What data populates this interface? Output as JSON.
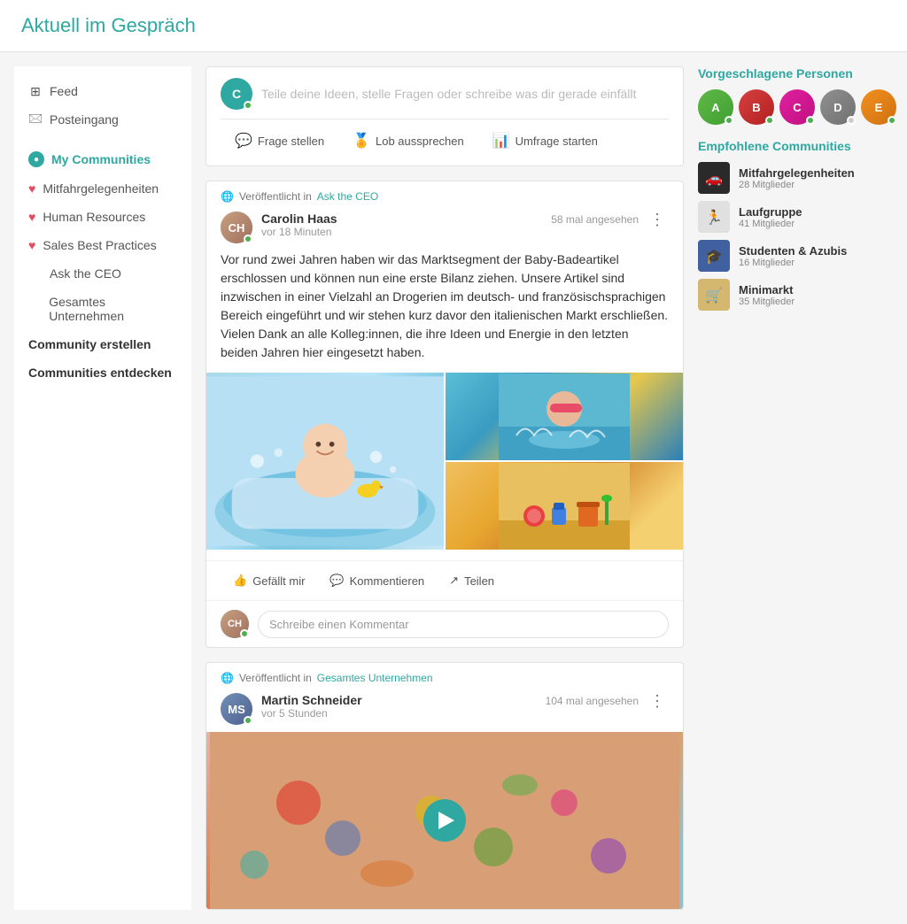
{
  "app": {
    "title": "Aktuell im Gespräch"
  },
  "sidebar": {
    "items": [
      {
        "id": "feed",
        "label": "Feed",
        "icon": "grid",
        "type": "nav"
      },
      {
        "id": "inbox",
        "label": "Posteingang",
        "icon": "inbox",
        "type": "nav"
      },
      {
        "id": "my-communities",
        "label": "My Communities",
        "icon": "community",
        "type": "section",
        "active": true
      },
      {
        "id": "mitfahrgelegenheiten",
        "label": "Mitfahrgelegenheiten",
        "icon": "heart",
        "type": "community"
      },
      {
        "id": "human-resources",
        "label": "Human Resources",
        "icon": "heart",
        "type": "community"
      },
      {
        "id": "sales-best-practices",
        "label": "Sales Best Practices",
        "icon": "heart",
        "type": "community"
      },
      {
        "id": "ask-the-ceo",
        "label": "Ask the CEO",
        "icon": "none",
        "type": "community"
      },
      {
        "id": "gesamtes-unternehmen",
        "label": "Gesamtes Unternehmen",
        "icon": "none",
        "type": "community"
      },
      {
        "id": "community-erstellen",
        "label": "Community erstellen",
        "icon": "none",
        "type": "action",
        "bold": true
      },
      {
        "id": "communities-entdecken",
        "label": "Communities entdecken",
        "icon": "none",
        "type": "action",
        "bold": true
      }
    ]
  },
  "composer": {
    "placeholder": "Teile deine Ideen, stelle Fragen oder schreibe was dir gerade einfällt",
    "actions": [
      {
        "id": "frage",
        "label": "Frage stellen",
        "icon": "💬"
      },
      {
        "id": "lob",
        "label": "Lob aussprechen",
        "icon": "🏅"
      },
      {
        "id": "umfrage",
        "label": "Umfrage starten",
        "icon": "📊"
      }
    ]
  },
  "posts": [
    {
      "id": "post-1",
      "published_in": "Veröffentlicht in",
      "community": "Ask the CEO",
      "author_name": "Carolin Haas",
      "time_ago": "vor 18 Minuten",
      "view_count": "58 mal angesehen",
      "body": "Vor rund zwei Jahren haben wir das Marktsegment der Baby-Badeartikel erschlossen und können nun eine erste Bilanz ziehen. Unsere Artikel sind inzwischen in einer Vielzahl an Drogerien im deutsch- und französischsprachigen Bereich eingeführt und wir stehen kurz davor den italienischen Markt erschließen. Vielen Dank an alle Kolleg:innen, die ihre Ideen und Energie in den letzten beiden Jahren hier eingesetzt haben.",
      "has_images": true,
      "action_labels": {
        "like": "Gefällt mir",
        "comment": "Kommentieren",
        "share": "Teilen"
      },
      "comment_placeholder": "Schreibe einen Kommentar"
    },
    {
      "id": "post-2",
      "published_in": "Veröffentlicht in",
      "community": "Gesamtes Unternehmen",
      "author_name": "Martin Schneider",
      "time_ago": "vor 5 Stunden",
      "view_count": "104 mal angesehen",
      "has_video": true
    }
  ],
  "right_sidebar": {
    "suggested_title": "Vorgeschlagene Personen",
    "suggested_people": [
      {
        "id": "p1",
        "color": "av-green",
        "status": "online"
      },
      {
        "id": "p2",
        "color": "av-red",
        "status": "online"
      },
      {
        "id": "p3",
        "color": "av-pink",
        "status": "online"
      },
      {
        "id": "p4",
        "color": "av-gray",
        "status": "offline"
      },
      {
        "id": "p5",
        "color": "av-orange",
        "status": "online"
      }
    ],
    "communities_title": "Empfohlene Communities",
    "communities": [
      {
        "id": "c1",
        "name": "Mitfahrgelegenheiten",
        "members": "28 Mitglieder",
        "theme": "cars"
      },
      {
        "id": "c2",
        "name": "Laufgruppe",
        "members": "41 Mitglieder",
        "theme": "running"
      },
      {
        "id": "c3",
        "name": "Studenten & Azubis",
        "members": "16 Mitglieder",
        "theme": "students"
      },
      {
        "id": "c4",
        "name": "Minimarkt",
        "members": "35 Mitglieder",
        "theme": "mini"
      }
    ]
  }
}
